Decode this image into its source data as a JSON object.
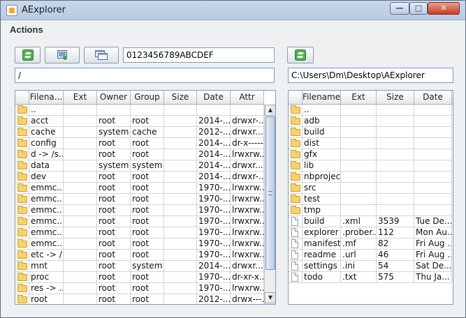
{
  "window": {
    "title": "AExplorer",
    "minimize_glyph": "—",
    "maximize_glyph": "□",
    "close_glyph": "✕"
  },
  "menu": {
    "actions_label": "Actions"
  },
  "left": {
    "hex_field": "0123456789ABCDEF",
    "path": "/",
    "columns": [
      "Filena...",
      "Ext",
      "Owner",
      "Group",
      "Size",
      "Date",
      "Attr"
    ],
    "rows": [
      {
        "icon": "folder-icon",
        "name": "..",
        "ext": "",
        "owner": "",
        "group": "",
        "size": "",
        "date": "",
        "attr": ""
      },
      {
        "icon": "folder-icon",
        "name": "acct",
        "ext": "",
        "owner": "root",
        "group": "root",
        "size": "",
        "date": "2014-...",
        "attr": "drwxr-..."
      },
      {
        "icon": "folder-icon",
        "name": "cache",
        "ext": "",
        "owner": "system",
        "group": "cache",
        "size": "",
        "date": "2012-...",
        "attr": "drwxr..."
      },
      {
        "icon": "folder-icon",
        "name": "config",
        "ext": "",
        "owner": "root",
        "group": "root",
        "size": "",
        "date": "2014-...",
        "attr": "dr-x------"
      },
      {
        "icon": "folder-icon",
        "name": "d -> /s...",
        "ext": "",
        "owner": "root",
        "group": "root",
        "size": "",
        "date": "2014-...",
        "attr": "lrwxrw..."
      },
      {
        "icon": "folder-icon",
        "name": "data",
        "ext": "",
        "owner": "system",
        "group": "system",
        "size": "",
        "date": "2014-...",
        "attr": "drwxr..."
      },
      {
        "icon": "folder-icon",
        "name": "dev",
        "ext": "",
        "owner": "root",
        "group": "root",
        "size": "",
        "date": "2014-...",
        "attr": "drwxr-..."
      },
      {
        "icon": "folder-icon",
        "name": "emmc...",
        "ext": "",
        "owner": "root",
        "group": "root",
        "size": "",
        "date": "1970-...",
        "attr": "lrwxrw..."
      },
      {
        "icon": "folder-icon",
        "name": "emmc...",
        "ext": "",
        "owner": "root",
        "group": "root",
        "size": "",
        "date": "1970-...",
        "attr": "lrwxrw..."
      },
      {
        "icon": "folder-icon",
        "name": "emmc...",
        "ext": "",
        "owner": "root",
        "group": "root",
        "size": "",
        "date": "1970-...",
        "attr": "lrwxrw..."
      },
      {
        "icon": "folder-icon",
        "name": "emmc...",
        "ext": "",
        "owner": "root",
        "group": "root",
        "size": "",
        "date": "1970-...",
        "attr": "lrwxrw..."
      },
      {
        "icon": "folder-icon",
        "name": "emmc...",
        "ext": "",
        "owner": "root",
        "group": "root",
        "size": "",
        "date": "1970-...",
        "attr": "lrwxrw..."
      },
      {
        "icon": "folder-icon",
        "name": "emmc...",
        "ext": "",
        "owner": "root",
        "group": "root",
        "size": "",
        "date": "1970-...",
        "attr": "lrwxrw..."
      },
      {
        "icon": "folder-icon",
        "name": "etc -> /...",
        "ext": "",
        "owner": "root",
        "group": "root",
        "size": "",
        "date": "1970-...",
        "attr": "lrwxrw..."
      },
      {
        "icon": "folder-icon",
        "name": "mnt",
        "ext": "",
        "owner": "root",
        "group": "system",
        "size": "",
        "date": "2014-...",
        "attr": "drwxr..."
      },
      {
        "icon": "folder-icon",
        "name": "proc",
        "ext": "",
        "owner": "root",
        "group": "root",
        "size": "",
        "date": "1970-...",
        "attr": "dr-xr-x..."
      },
      {
        "icon": "folder-icon",
        "name": "res -> ...",
        "ext": "",
        "owner": "root",
        "group": "root",
        "size": "",
        "date": "1970-...",
        "attr": "lrwxrw..."
      },
      {
        "icon": "folder-icon",
        "name": "root",
        "ext": "",
        "owner": "root",
        "group": "root",
        "size": "",
        "date": "2012-...",
        "attr": "drwx---..."
      }
    ]
  },
  "right": {
    "path": "C:\\Users\\Dm\\Desktop\\AExplorer",
    "columns": [
      "Filename",
      "Ext",
      "Size",
      "Date"
    ],
    "rows": [
      {
        "icon": "folder-icon",
        "name": "..",
        "ext": "",
        "size": "",
        "date": ""
      },
      {
        "icon": "folder-icon",
        "name": "adb",
        "ext": "",
        "size": "",
        "date": ""
      },
      {
        "icon": "folder-icon",
        "name": "build",
        "ext": "",
        "size": "",
        "date": ""
      },
      {
        "icon": "folder-icon",
        "name": "dist",
        "ext": "",
        "size": "",
        "date": ""
      },
      {
        "icon": "folder-icon",
        "name": "gfx",
        "ext": "",
        "size": "",
        "date": ""
      },
      {
        "icon": "folder-icon",
        "name": "lib",
        "ext": "",
        "size": "",
        "date": ""
      },
      {
        "icon": "folder-icon",
        "name": "nbproject",
        "ext": "",
        "size": "",
        "date": ""
      },
      {
        "icon": "folder-icon",
        "name": "src",
        "ext": "",
        "size": "",
        "date": ""
      },
      {
        "icon": "folder-icon",
        "name": "test",
        "ext": "",
        "size": "",
        "date": ""
      },
      {
        "icon": "folder-icon",
        "name": "tmp",
        "ext": "",
        "size": "",
        "date": ""
      },
      {
        "icon": "file-icon",
        "name": "build",
        "ext": ".xml",
        "size": "3539",
        "date": "Tue De..."
      },
      {
        "icon": "file-icon",
        "name": "explorer",
        "ext": ".prober...",
        "size": "112",
        "date": "Mon Au..."
      },
      {
        "icon": "file-icon",
        "name": "manifest",
        "ext": ".mf",
        "size": "82",
        "date": "Fri Aug ..."
      },
      {
        "icon": "file-icon",
        "name": "readme",
        "ext": ".url",
        "size": "46",
        "date": "Fri Aug ..."
      },
      {
        "icon": "file-icon",
        "name": "settings",
        "ext": ".ini",
        "size": "54",
        "date": "Sat De..."
      },
      {
        "icon": "file-icon",
        "name": "todo",
        "ext": ".txt",
        "size": "575",
        "date": "Thu Ja..."
      }
    ]
  },
  "scrollbar": {
    "up_glyph": "▲",
    "down_glyph": "▼"
  }
}
